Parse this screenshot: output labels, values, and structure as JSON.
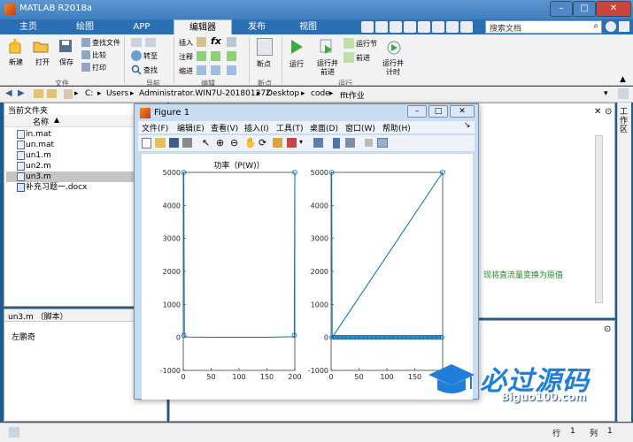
{
  "app": {
    "title": "MATLAB R2018a",
    "tabs": [
      "主页",
      "绘图",
      "APP",
      "编辑器",
      "发布",
      "视图"
    ],
    "active_tab": "编辑器",
    "search_placeholder": "搜索文档"
  },
  "ribbon": {
    "file_group": {
      "label": "文件",
      "new": "新建",
      "open": "打开",
      "save": "保存",
      "find_files": "查找文件",
      "compare": "比较",
      "print": "打印"
    },
    "navigate_group": {
      "label": "导航",
      "goto": "转至",
      "find": "查找"
    },
    "edit_group": {
      "label": "编辑",
      "insert": "插入",
      "comment": "注释",
      "indent": "缩进",
      "fx": "fx"
    },
    "breakpoints_group": {
      "label": "断点",
      "breakpoints": "断点"
    },
    "run_group": {
      "label": "运行",
      "run": "运行",
      "run_advance": "运行并\n前进",
      "run_section": "运行节",
      "advance": "前进",
      "run_time": "运行并\n计时"
    }
  },
  "address": {
    "segments": [
      "C:",
      "Users",
      "Administrator.WIN7U-20180127Z",
      "Desktop",
      "code",
      "fft作业"
    ]
  },
  "current_folder": {
    "title": "当前文件夹",
    "column_name": "名称",
    "files": [
      {
        "name": "in.mat",
        "selected": false
      },
      {
        "name": "un.mat",
        "selected": false
      },
      {
        "name": "un1.m",
        "selected": false
      },
      {
        "name": "un2.m",
        "selected": false
      },
      {
        "name": "un3.m",
        "selected": true
      },
      {
        "name": "补充习题一.docx",
        "selected": false
      }
    ]
  },
  "details": {
    "title": "un3.m （脚本）",
    "content": "左鹏奇"
  },
  "editor": {
    "comment_text": "现将直流量变换为原值"
  },
  "right_panel": {
    "label": "工作区"
  },
  "figure": {
    "title": "Figure 1",
    "menus": [
      "文件(F)",
      "编辑(E)",
      "查看(V)",
      "插入(I)",
      "工具(T)",
      "桌面(D)",
      "窗口(W)",
      "帮助(H)"
    ]
  },
  "chart_data": [
    {
      "type": "line",
      "title": "功率（P(W)）",
      "xlabel": "",
      "ylabel": "",
      "xlim": [
        0,
        200
      ],
      "ylim": [
        -1000,
        5000
      ],
      "xticks": [
        0,
        50,
        100,
        150,
        200
      ],
      "yticks": [
        -1000,
        0,
        1000,
        2000,
        3000,
        4000,
        5000
      ],
      "series": [
        {
          "x": [
            1,
            2,
            3,
            10,
            50,
            100,
            150,
            198,
            199,
            200
          ],
          "y": [
            5000,
            60,
            20,
            10,
            5,
            5,
            5,
            20,
            60,
            5000
          ]
        }
      ],
      "marker_points": [
        {
          "x": 1,
          "y": 5000
        },
        {
          "x": 200,
          "y": 5000
        },
        {
          "x": 1,
          "y": 60
        },
        {
          "x": 199,
          "y": 60
        }
      ],
      "grid": false
    },
    {
      "type": "line",
      "title": "",
      "xlabel": "",
      "ylabel": "",
      "xlim": [
        0,
        200
      ],
      "ylim": [
        -1000,
        5000
      ],
      "xticks": [
        0,
        50,
        100,
        150
      ],
      "yticks": [
        -1000,
        0,
        1000,
        2000,
        3000,
        4000,
        5000
      ],
      "series": [
        {
          "x": [
            1,
            2,
            200
          ],
          "y": [
            5000,
            0,
            5000
          ]
        }
      ],
      "marker_points": [
        {
          "x": 1,
          "y": 5000
        },
        {
          "x": 200,
          "y": 5000
        }
      ],
      "dense_markers_at_zero": true,
      "grid": false
    }
  ],
  "watermark": {
    "main": "必过源码",
    "sub": "Biguo100.com"
  },
  "status": {
    "row_label": "行",
    "row": "1",
    "col_label": "列",
    "col": "1"
  }
}
